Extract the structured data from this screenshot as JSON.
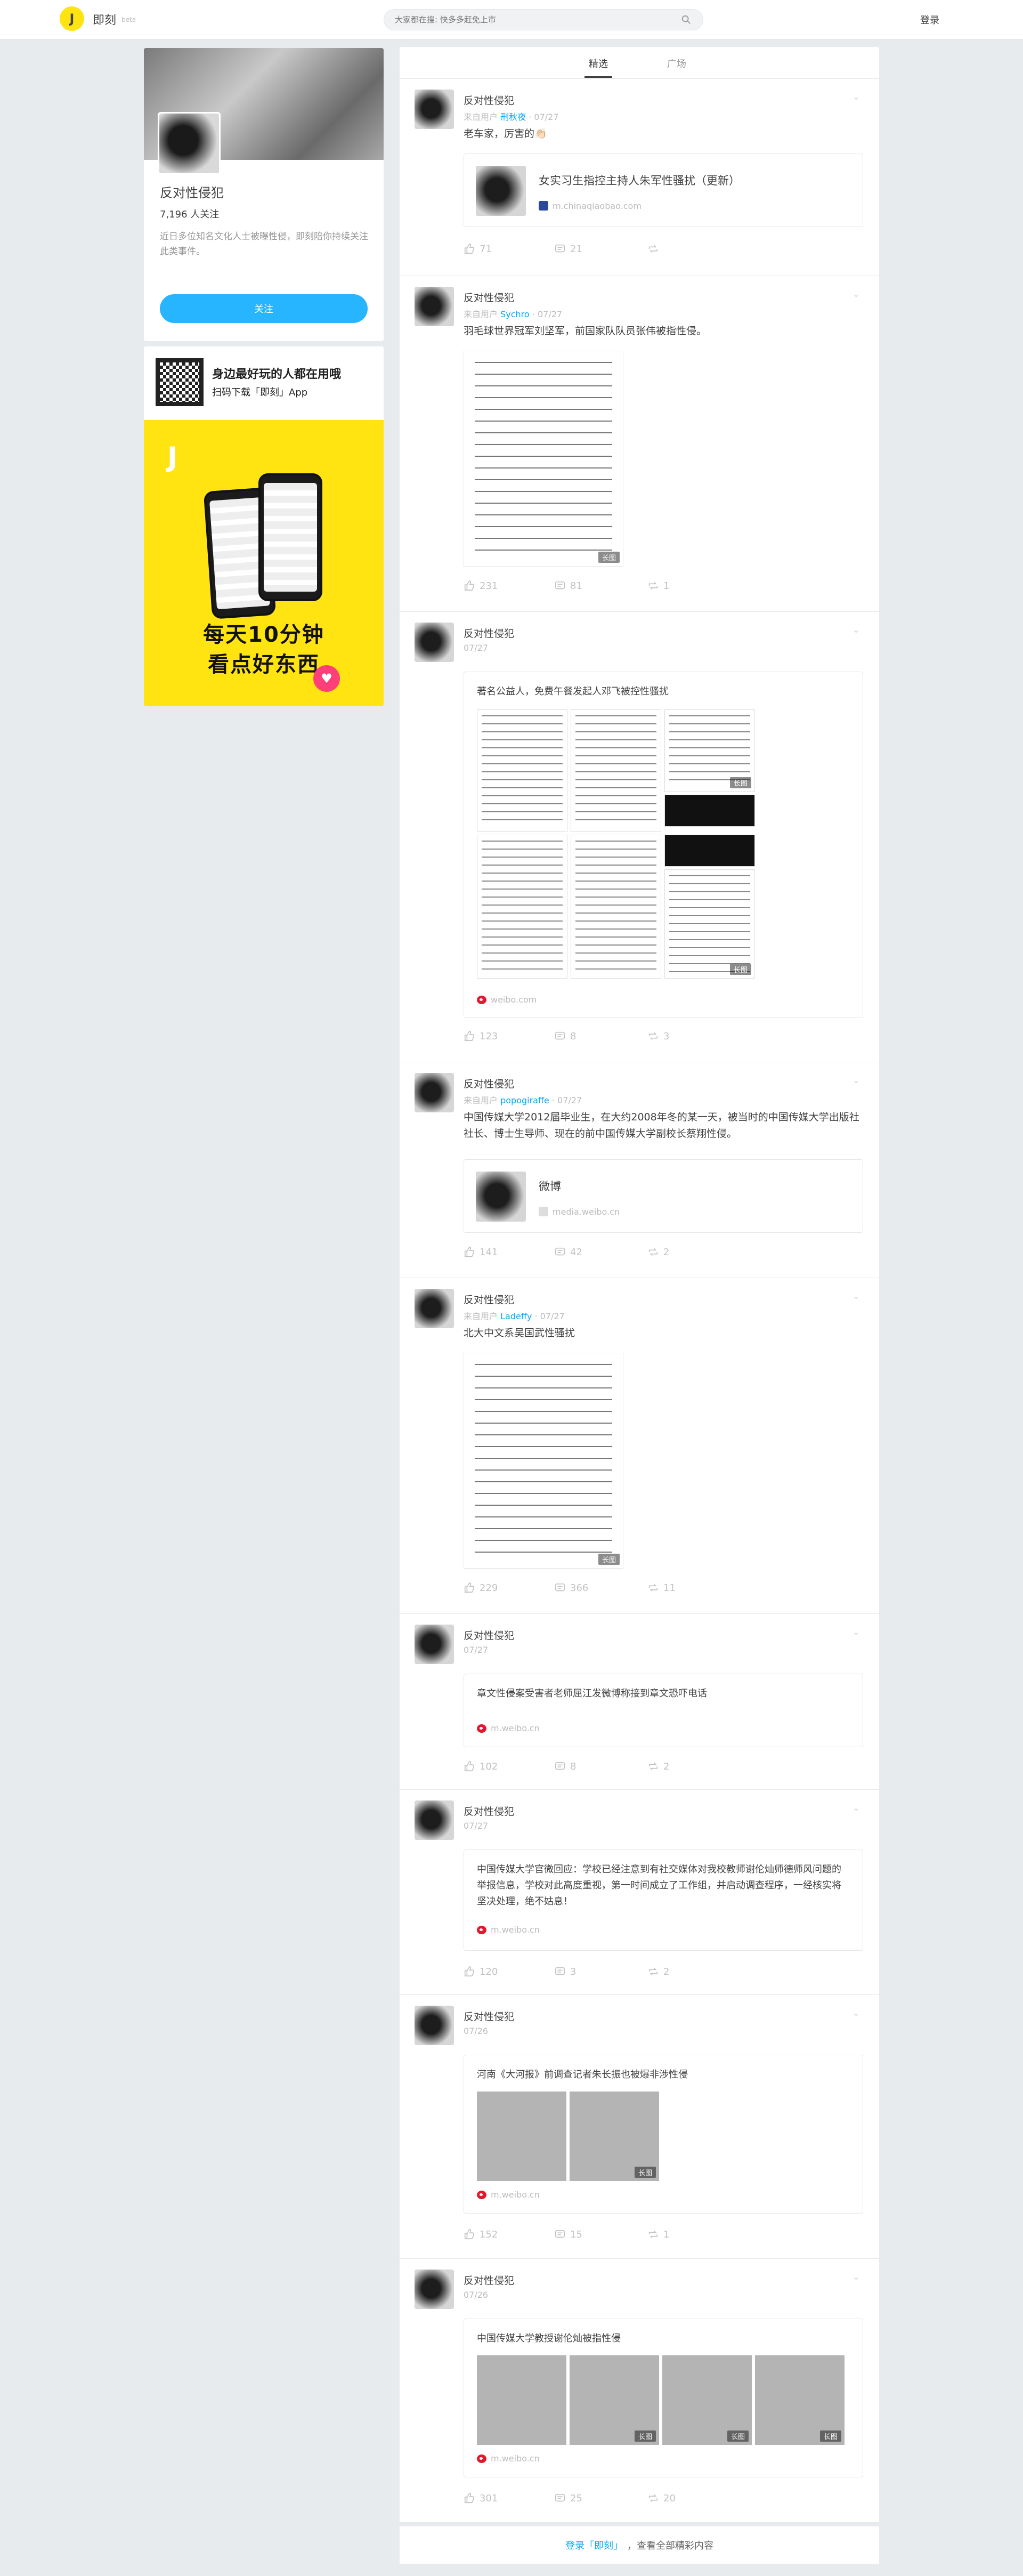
{
  "header": {
    "logo_letter": "J",
    "app_name": "即刻",
    "beta": "beta",
    "search_placeholder": "大家都在搜: 快多多赶免上市",
    "login": "登录"
  },
  "profile": {
    "name": "反对性侵犯",
    "followers": "7,196 人关注",
    "description": "近日多位知名文化人士被曝性侵，即刻陪你持续关注此类事件。",
    "follow_button": "关注"
  },
  "app_ad": {
    "line1": "身边最好玩的人都在用哦",
    "line2": "扫码下载「即刻」App",
    "logo": "J",
    "slogan1": "每天10分钟",
    "slogan2": "看点好东西"
  },
  "tabs": [
    {
      "label": "精选",
      "active": true
    },
    {
      "label": "广场",
      "active": false
    }
  ],
  "colors": {
    "accent": "#27b5ff",
    "brand_yellow": "#ffe411",
    "link_blue": "#03a9f4",
    "weibo_red": "#e6162d"
  },
  "posts": [
    {
      "author": "反对性侵犯",
      "source": "来自用户",
      "user": "刑秋夜",
      "date": "07/27",
      "text": "老车家，厉害的👏🏻",
      "link_title": "女实习生指控主持人朱军性骚扰（更新）",
      "link_src": "m.chinaqiaobao.com",
      "likes": "71",
      "comments": "21",
      "shares": ""
    },
    {
      "author": "反对性侵犯",
      "source": "来自用户",
      "user": "Sychro",
      "date": "07/27",
      "text": "羽毛球世界冠军刘坚军，前国家队队员张伟被指性侵。",
      "image_badge": "长图",
      "likes": "231",
      "comments": "81",
      "shares": "1"
    },
    {
      "author": "反对性侵犯",
      "date": "07/27",
      "card_text": "著名公益人，免费午餐发起人邓飞被控性骚扰",
      "badge1": "长图",
      "badge2": "长图",
      "card_src": "weibo.com",
      "likes": "123",
      "comments": "8",
      "shares": "3"
    },
    {
      "author": "反对性侵犯",
      "source": "来自用户",
      "user": "popogiraffe",
      "date": "07/27",
      "text": "中国传媒大学2012届毕业生，在大约2008年冬的某一天，被当时的中国传媒大学出版社社长、博士生导师、现在的前中国传媒大学副校长蔡翔性侵。",
      "link_title": "微博",
      "link_src": "media.weibo.cn",
      "likes": "141",
      "comments": "42",
      "shares": "2"
    },
    {
      "author": "反对性侵犯",
      "source": "来自用户",
      "user": "Ladeffy",
      "date": "07/27",
      "text": "北大中文系吴国武性骚扰",
      "image_badge": "长图",
      "likes": "229",
      "comments": "366",
      "shares": "11"
    },
    {
      "author": "反对性侵犯",
      "date": "07/27",
      "card_text": "章文性侵案受害者老师屈江发微博称接到章文恐吓电话",
      "card_src": "m.weibo.cn",
      "likes": "102",
      "comments": "8",
      "shares": "2"
    },
    {
      "author": "反对性侵犯",
      "date": "07/27",
      "card_text": "中国传媒大学官微回应：学校已经注意到有社交媒体对我校教师谢伦灿师德师风问题的举报信息，学校对此高度重视，第一时间成立了工作组，并启动调查程序，一经核实将坚决处理，绝不姑息！",
      "card_src": "m.weibo.cn",
      "likes": "120",
      "comments": "3",
      "shares": "2"
    },
    {
      "author": "反对性侵犯",
      "date": "07/26",
      "card_text": "河南《大河报》前调查记者朱长振也被爆非涉性侵",
      "badge1": "长图",
      "card_src": "m.weibo.cn",
      "likes": "152",
      "comments": "15",
      "shares": "1"
    },
    {
      "author": "反对性侵犯",
      "date": "07/26",
      "card_text": "中国传媒大学教授谢伦灿被指性侵",
      "badge1": "长图",
      "card_src": "m.weibo.cn",
      "likes": "301",
      "comments": "25",
      "shares": "20"
    }
  ],
  "footer": {
    "login_link": "登录「即刻」",
    "rest": "，查看全部精彩内容"
  }
}
